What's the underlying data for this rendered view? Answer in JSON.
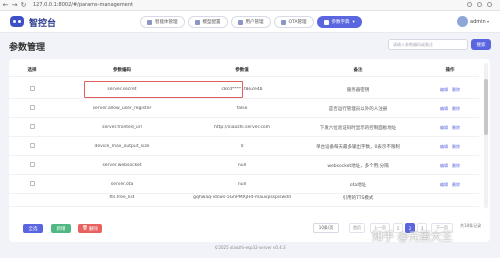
{
  "browser": {
    "url": "127.0.0.1:8002/#/params-management",
    "back_glyph": "←",
    "forward_glyph": "→",
    "reload_glyph": "↻"
  },
  "header": {
    "app_title": "智控台",
    "nav": [
      {
        "label": "智能体管理",
        "icon": "robot-icon",
        "active": false
      },
      {
        "label": "模型配置",
        "icon": "model-icon",
        "active": false
      },
      {
        "label": "用户管理",
        "icon": "users-icon",
        "active": false
      },
      {
        "label": "OTA管理",
        "icon": "ota-icon",
        "active": false
      },
      {
        "label": "参数字典",
        "icon": "dict-icon",
        "active": true
      }
    ],
    "user": {
      "name": "admin",
      "caret": "▾"
    }
  },
  "page": {
    "title": "参数管理",
    "search": {
      "placeholder": "请输入参数编码或备注",
      "button": "搜索"
    }
  },
  "table": {
    "columns": [
      "选择",
      "参数编码",
      "参数值",
      "备注",
      "操作"
    ],
    "rows": [
      {
        "code": "server.secret",
        "value": "c8cd****1f8e2e4b",
        "remark": "服务器密钥"
      },
      {
        "code": "server.allow_user_register",
        "value": "false",
        "remark": "是否运行管理员以外的人注册"
      },
      {
        "code": "server.fronted_url",
        "value": "http://xiaozhi.server.com",
        "remark": "下发六位验证码时显示的控制面板地址"
      },
      {
        "code": "device_max_output_size",
        "value": "0",
        "remark": "单台设备每天最多输出字数，0表示不限制"
      },
      {
        "code": "server.websocket",
        "value": "null",
        "remark": "websocket地址，多个用;分隔"
      },
      {
        "code": "server.ota",
        "value": "null",
        "remark": "ota地址"
      },
      {
        "code": "tts.free_list",
        "value": "gqhwaq-idcws-5GhPMXjHd-mauvpsspiswdd",
        "remark": "引用的TTS模式"
      }
    ],
    "row_actions": {
      "edit": "编辑",
      "delete": "删除"
    }
  },
  "actions": {
    "select_all": "全选",
    "add": "新增",
    "delete": "删除"
  },
  "pagination": {
    "page_size": "10条/页",
    "first": "首页",
    "prev": "上一页",
    "pages": [
      "1",
      "2",
      "3"
    ],
    "current": "2",
    "next": "下一页",
    "total": "共18条记录"
  },
  "footer": {
    "text": "©2025 xiaozhi-esp32-server v0.4.3"
  },
  "watermark": {
    "text": "知乎 @元蛋大王"
  },
  "colors": {
    "accent": "#5a66e0",
    "success": "#52b883",
    "danger": "#e86262",
    "highlight": "#e06060"
  }
}
